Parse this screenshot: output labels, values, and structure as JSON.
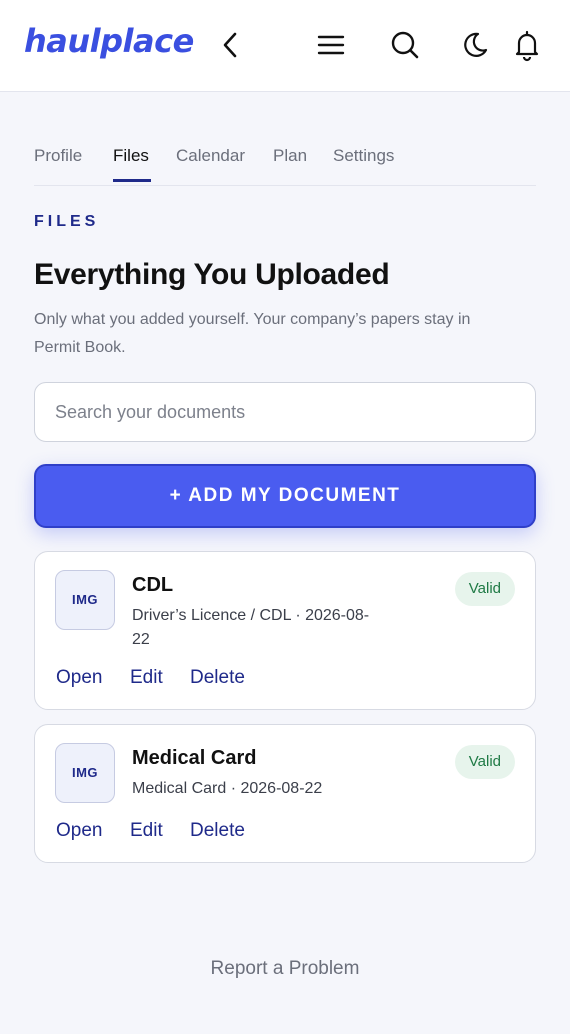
{
  "app": {
    "logo": "haulplace"
  },
  "icons": {
    "back": "chevron-left-icon",
    "menu": "hamburger-menu-icon",
    "search": "search-icon",
    "theme": "moon-icon",
    "notifications": "bell-icon"
  },
  "tabs": [
    {
      "label": "Profile",
      "active": false
    },
    {
      "label": "Files",
      "active": true
    },
    {
      "label": "Calendar",
      "active": false
    },
    {
      "label": "Plan",
      "active": false
    },
    {
      "label": "Settings",
      "active": false
    }
  ],
  "section_label": "FILES",
  "page_title": "Everything You Uploaded",
  "page_subtitle": "Only what you added yourself. Your company’s papers stay in Permit Book.",
  "search": {
    "placeholder": "Search your documents",
    "value": ""
  },
  "add_button_label": "+ ADD MY DOCUMENT",
  "documents": [
    {
      "thumb": "IMG",
      "title": "CDL",
      "meta": "Driver’s Licence / CDL · 2026-08-22",
      "status": "Valid",
      "actions": [
        "Open",
        "Edit",
        "Delete"
      ]
    },
    {
      "thumb": "IMG",
      "title": "Medical Card",
      "meta": "Medical Card · 2026-08-22",
      "status": "Valid",
      "actions": [
        "Open",
        "Edit",
        "Delete"
      ]
    }
  ],
  "footer_link": "Report a Problem",
  "colors": {
    "brand": "#3a4fe0",
    "primary_button": "#4a5cf0",
    "accent_text": "#1f2a8a",
    "valid_badge_bg": "#e7f4ec",
    "valid_badge_text": "#1f7a45",
    "background": "#f5f6fb"
  }
}
